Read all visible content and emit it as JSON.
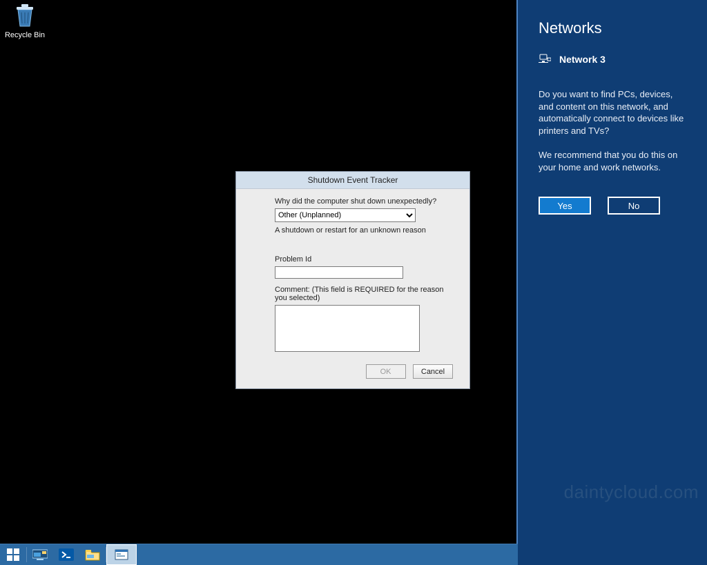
{
  "desktop": {
    "recycle_bin_label": "Recycle Bin"
  },
  "dialog": {
    "title": "Shutdown Event Tracker",
    "question": "Why did the computer shut down unexpectedly?",
    "reason_selected": "Other (Unplanned)",
    "reason_description": "A shutdown or restart for an unknown reason",
    "problem_id_label": "Problem Id",
    "problem_id_value": "",
    "comment_label": "Comment: (This field is REQUIRED for the reason you selected)",
    "comment_value": "",
    "ok_label": "OK",
    "cancel_label": "Cancel"
  },
  "networks": {
    "heading": "Networks",
    "item_label": "Network  3",
    "question": "Do you want to find PCs, devices, and content on this network, and automatically connect to devices like printers and TVs?",
    "recommendation": "We recommend that you do this on your home and work networks.",
    "yes_label": "Yes",
    "no_label": "No"
  },
  "watermark": "daintycloud.com",
  "taskbar": {
    "start": "start-button",
    "server_manager": "server-manager",
    "powershell": "powershell",
    "explorer": "file-explorer",
    "current": "shutdown-tracker-window"
  }
}
